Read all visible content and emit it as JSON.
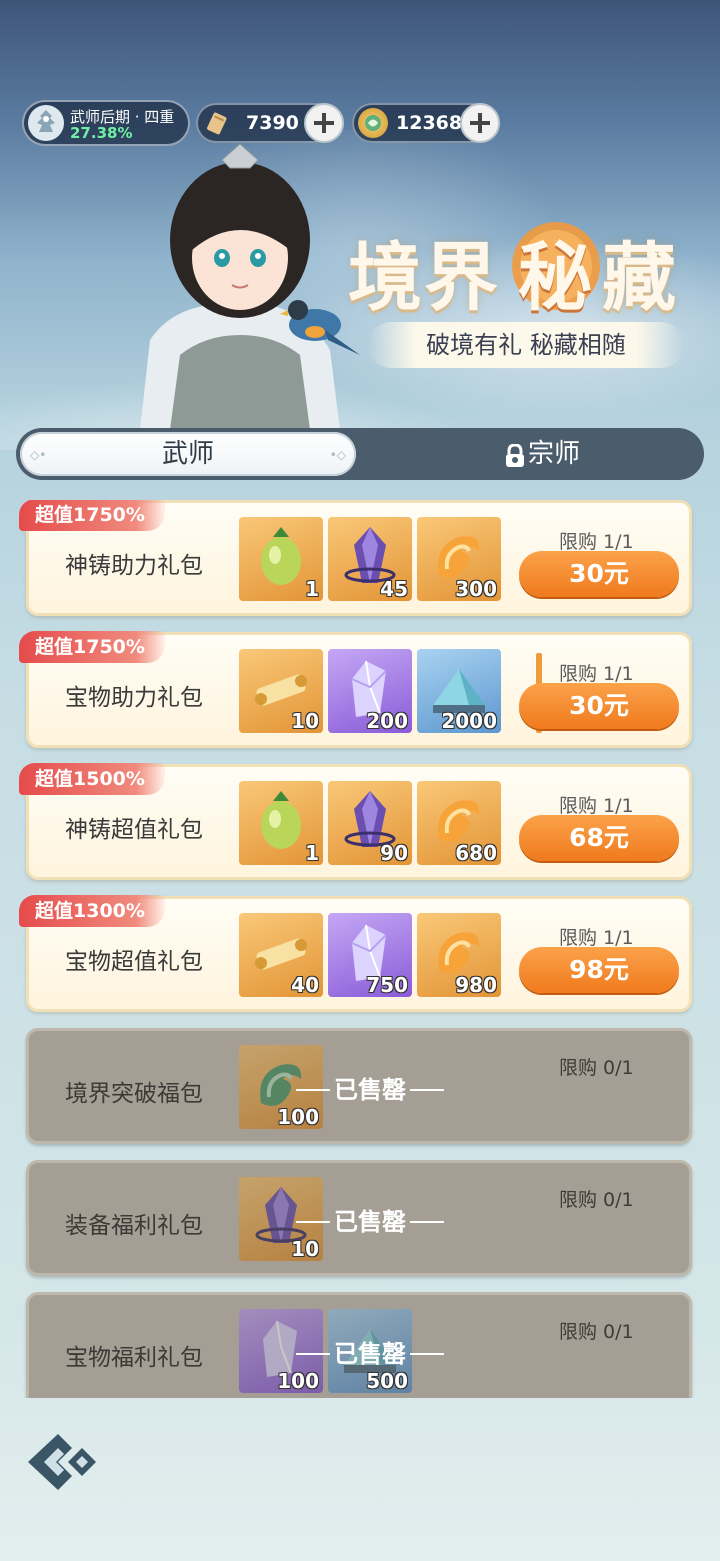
{
  "status": {
    "realm_name": "武师后期 · 四重",
    "realm_progress": "27.38%",
    "currencies": [
      {
        "icon": "scroll-icon",
        "value": "7390"
      },
      {
        "icon": "jade-coin-icon",
        "value": "12368"
      }
    ]
  },
  "banner": {
    "title_part1": "境界",
    "title_part2": "秘",
    "title_part3": "藏",
    "subtitle": "破境有礼 秘藏相随"
  },
  "tabs": [
    {
      "label": "武师",
      "active": true,
      "locked": false
    },
    {
      "label": "宗师",
      "active": false,
      "locked": true
    }
  ],
  "packs": [
    {
      "badge": "超值1750%",
      "name": "神铸助力礼包",
      "limit": "限购 1/1",
      "price": "30元",
      "sold_out": false,
      "items": [
        {
          "icon": "green-fruit-icon",
          "qty": "1",
          "bg": "orange"
        },
        {
          "icon": "purple-gem-icon",
          "qty": "45",
          "bg": "orange"
        },
        {
          "icon": "flame-cloud-icon",
          "qty": "300",
          "bg": "orange"
        }
      ]
    },
    {
      "badge": "超值1750%",
      "name": "宝物助力礼包",
      "limit": "限购 1/1",
      "price": "30元",
      "sold_out": false,
      "items": [
        {
          "icon": "golden-scroll-icon",
          "qty": "10",
          "bg": "orange"
        },
        {
          "icon": "crystal-shard-icon",
          "qty": "200",
          "bg": "purple"
        },
        {
          "icon": "jade-mountain-icon",
          "qty": "2000",
          "bg": "blue"
        }
      ]
    },
    {
      "badge": "超值1500%",
      "name": "神铸超值礼包",
      "limit": "限购 1/1",
      "price": "68元",
      "sold_out": false,
      "items": [
        {
          "icon": "green-fruit-icon",
          "qty": "1",
          "bg": "orange"
        },
        {
          "icon": "purple-gem-icon",
          "qty": "90",
          "bg": "orange"
        },
        {
          "icon": "flame-cloud-icon",
          "qty": "680",
          "bg": "orange"
        }
      ]
    },
    {
      "badge": "超值1300%",
      "name": "宝物超值礼包",
      "limit": "限购 1/1",
      "price": "98元",
      "sold_out": false,
      "items": [
        {
          "icon": "golden-scroll-icon",
          "qty": "40",
          "bg": "orange"
        },
        {
          "icon": "crystal-shard-icon",
          "qty": "750",
          "bg": "purple"
        },
        {
          "icon": "flame-cloud-icon",
          "qty": "980",
          "bg": "orange"
        }
      ]
    },
    {
      "badge": "",
      "name": "境界突破福包",
      "limit": "限购 0/1",
      "price": "",
      "sold_out": true,
      "sold_label": "已售罄",
      "items": [
        {
          "icon": "jade-cloud-icon",
          "qty": "100",
          "bg": "orange"
        }
      ]
    },
    {
      "badge": "",
      "name": "装备福利礼包",
      "limit": "限购 0/1",
      "price": "",
      "sold_out": true,
      "sold_label": "已售罄",
      "items": [
        {
          "icon": "purple-gem-icon",
          "qty": "10",
          "bg": "orange"
        }
      ]
    },
    {
      "badge": "",
      "name": "宝物福利礼包",
      "limit": "限购 0/1",
      "price": "",
      "sold_out": true,
      "sold_label": "已售罄",
      "items": [
        {
          "icon": "crystal-shard-icon",
          "qty": "100",
          "bg": "purple"
        },
        {
          "icon": "jade-mountain-icon",
          "qty": "500",
          "bg": "blue"
        }
      ]
    }
  ],
  "colors": {
    "accent_orange": "#f07a1d",
    "badge_red": "#e54b4b",
    "tab_dark": "#4b5d6d"
  }
}
